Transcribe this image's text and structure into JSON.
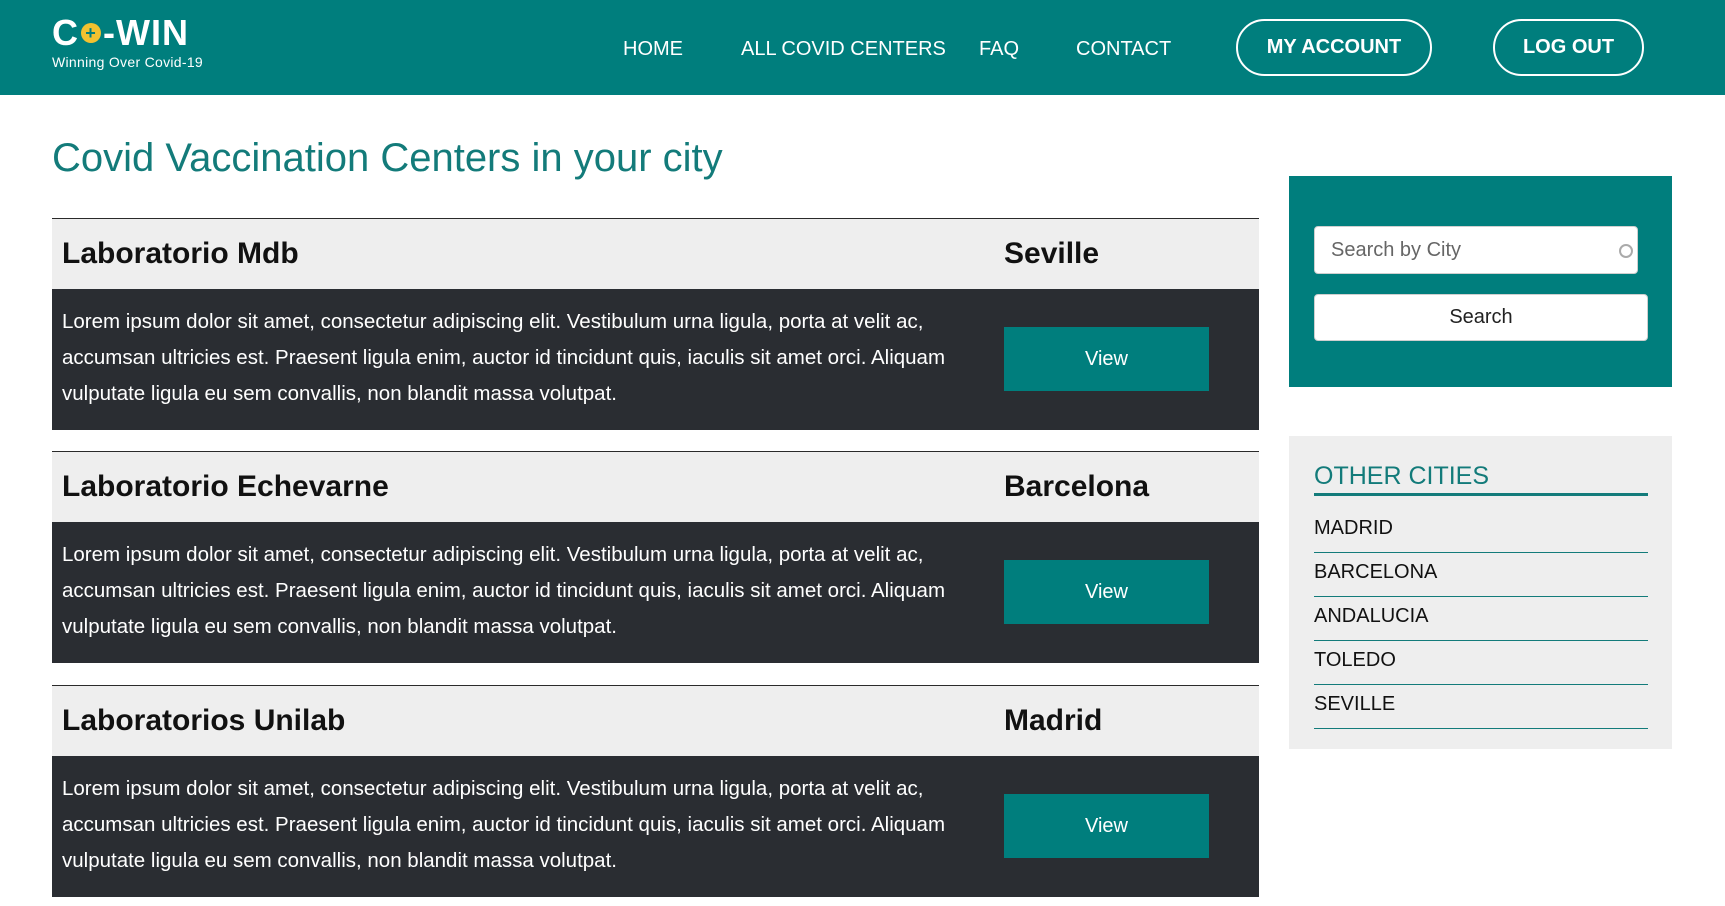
{
  "brand": {
    "logo_prefix": "C",
    "logo_plus": "+",
    "logo_suffix": "-WIN",
    "tagline": "Winning Over Covid-19"
  },
  "nav": {
    "home": "HOME",
    "all_centers": "ALL COVID CENTERS",
    "faq": "FAQ",
    "contact": "CONTACT",
    "my_account": "MY ACCOUNT",
    "log_out": "LOG OUT"
  },
  "page": {
    "title": "Covid Vaccination Centers in your city"
  },
  "centers": [
    {
      "name": "Laboratorio Mdb",
      "city": "Seville",
      "description": "Lorem ipsum dolor sit amet, consectetur adipiscing elit. Vestibulum urna ligula, porta at velit ac, accumsan ultricies est. Praesent ligula enim, auctor id tincidunt quis, iaculis sit amet orci. Aliquam vulputate ligula eu sem convallis, non blandit massa volutpat.",
      "button": "View"
    },
    {
      "name": "Laboratorio Echevarne",
      "city": "Barcelona",
      "description": "Lorem ipsum dolor sit amet, consectetur adipiscing elit. Vestibulum urna ligula, porta at velit ac, accumsan ultricies est. Praesent ligula enim, auctor id tincidunt quis, iaculis sit amet orci. Aliquam vulputate ligula eu sem convallis, non blandit massa volutpat.",
      "button": "View"
    },
    {
      "name": "Laboratorios Unilab",
      "city": "Madrid",
      "description": "Lorem ipsum dolor sit amet, consectetur adipiscing elit. Vestibulum urna ligula, porta at velit ac, accumsan ultricies est. Praesent ligula enim, auctor id tincidunt quis, iaculis sit amet orci. Aliquam vulputate ligula eu sem convallis, non blandit massa volutpat.",
      "button": "View"
    }
  ],
  "search": {
    "placeholder": "Search by City",
    "value": "",
    "button": "Search"
  },
  "other_cities": {
    "title": "OTHER CITIES",
    "items": [
      "MADRID",
      "BARCELONA",
      "ANDALUCIA",
      "TOLEDO",
      "SEVILLE"
    ]
  },
  "colors": {
    "brand_teal": "#007e7d",
    "title_teal": "#137b7a",
    "card_dark": "#2a2d32",
    "card_light": "#eeeeee",
    "logo_accent": "#f2c230"
  },
  "icons": {
    "logo_plus": "plus-circle-icon",
    "search_clear": "clear-circle-icon"
  }
}
